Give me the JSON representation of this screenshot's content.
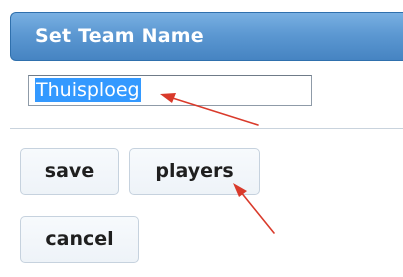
{
  "dialog": {
    "title": "Set Team Name"
  },
  "team_name_input": {
    "value": "Thuisploeg"
  },
  "buttons": {
    "save": "save",
    "players": "players",
    "cancel": "cancel"
  },
  "colors": {
    "title_bar": "#5c98d2",
    "title_text": "#ffffff",
    "selection_highlight": "#3399ff",
    "annotation_arrow": "#d93a2b",
    "button_background": "#eef3f8",
    "button_border": "#c6d2de"
  }
}
